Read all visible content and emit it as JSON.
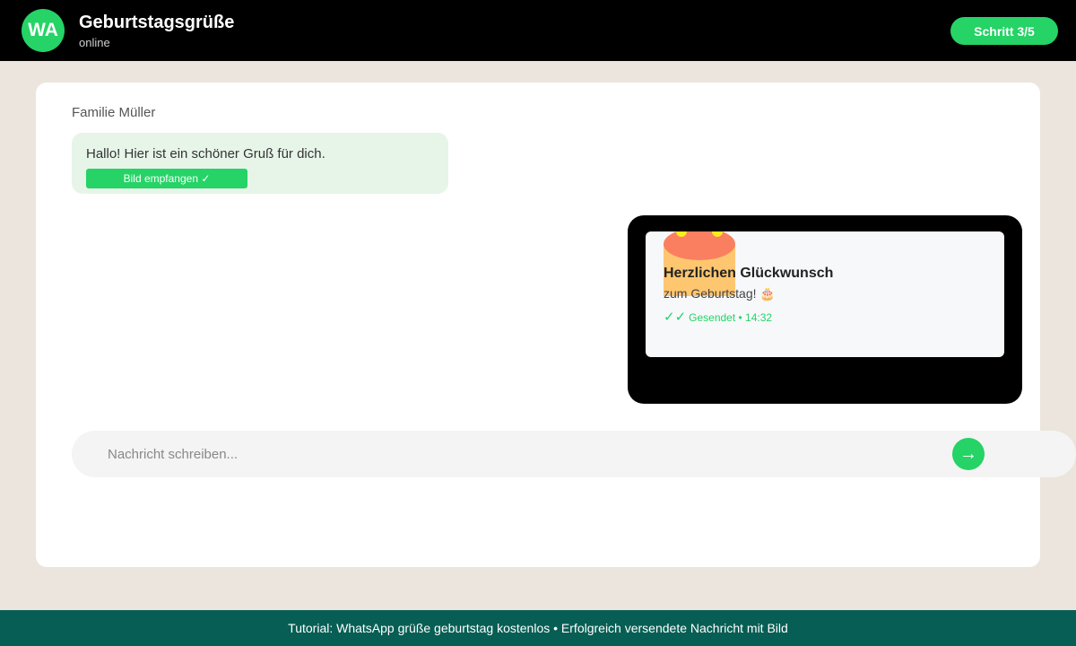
{
  "header": {
    "avatar_text": "WA",
    "title": "Geburtstagsgrüße",
    "status": "online",
    "step_label": "Schritt 3/5"
  },
  "chat": {
    "sender_name": "Familie Müller",
    "incoming": {
      "text": "Hallo! Hier ist ein schöner Gruß für dich.",
      "attachment_label": "Bild empfangen ✓"
    },
    "outgoing": {
      "title": "Herzlichen Glückwunsch",
      "subtitle": "zum Geburtstag! 🎂",
      "ticks": "✓✓",
      "status": "Gesendet • 14:32",
      "image_icon": "birthday-cake"
    }
  },
  "composer": {
    "placeholder": "Nachricht schreiben...",
    "value": "",
    "send_icon": "→"
  },
  "footer": {
    "text": "Tutorial: WhatsApp grüße geburtstag kostenlos • Erfolgreich versendete Nachricht mit Bild"
  },
  "colors": {
    "accent": "#25d366",
    "footer": "#075e54",
    "background": "#ece5dd"
  }
}
